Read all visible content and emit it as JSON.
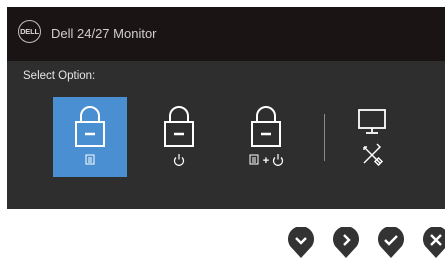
{
  "header": {
    "logo_text": "DELL",
    "title": "Dell 24/27 Monitor"
  },
  "main": {
    "prompt": "Select Option:",
    "options": [
      {
        "name": "Menu lock",
        "selected": true
      },
      {
        "name": "Power button lock",
        "selected": false
      },
      {
        "name": "Menu + Power button lock",
        "selected": false
      },
      {
        "name": "Built-in diagnostics",
        "selected": false
      }
    ],
    "plus_sign": "+"
  },
  "nav_buttons": [
    "down",
    "right",
    "ok",
    "close"
  ],
  "colors": {
    "selected": "#4a8fd1",
    "panel": "#2e2e2e",
    "titlebar": "#1b1415",
    "icon": "#ffffff",
    "nav_button": "#333333"
  }
}
